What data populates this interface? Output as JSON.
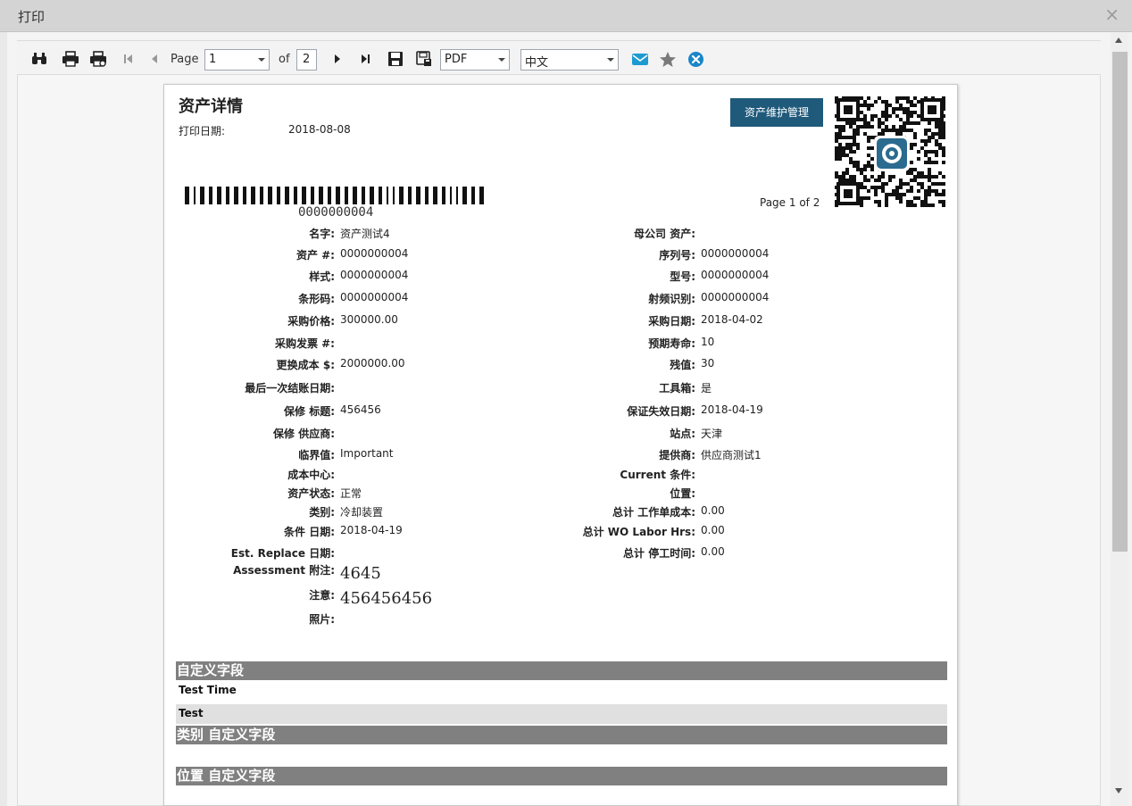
{
  "dialog": {
    "title": "打印",
    "close_glyph": "×"
  },
  "toolbar": {
    "page_label": "Page",
    "page_value": "1",
    "of_label": "of",
    "total_pages": "2",
    "format_value": "PDF",
    "language_value": "中文"
  },
  "report": {
    "title": "资产详情",
    "print_date_label": "打印日期:",
    "print_date_value": "2018-08-08",
    "brand_button": "资产维护管理",
    "barcode_number": "0000000004",
    "page_count": "Page 1 of 2",
    "left_fields": [
      {
        "label": "名字:",
        "value": "资产测试4"
      },
      {
        "label": "资产 #:",
        "value": "0000000004"
      },
      {
        "label": "样式:",
        "value": "0000000004"
      },
      {
        "label": "条形码:",
        "value": "0000000004"
      },
      {
        "label": "采购价格:",
        "value": "300000.00"
      },
      {
        "label": "采购发票 #:",
        "value": ""
      },
      {
        "label": "更换成本 $:",
        "value": "2000000.00"
      },
      {
        "label": "最后一次结账日期:",
        "value": ""
      },
      {
        "label": "保修 标题:",
        "value": "456456"
      },
      {
        "label": "保修 供应商:",
        "value": ""
      },
      {
        "label": "临界值:",
        "value": "Important"
      },
      {
        "label": "成本中心:",
        "value": ""
      },
      {
        "label": "资产状态:",
        "value": "正常"
      },
      {
        "label": "类别:",
        "value": "冷却装置"
      },
      {
        "label": "条件 日期:",
        "value": "2018-04-19"
      },
      {
        "label": "Est. Replace 日期:",
        "value": ""
      },
      {
        "label": "Assessment 附注:",
        "value": "4645"
      },
      {
        "label": "注意:",
        "value": "456456456"
      },
      {
        "label": "照片:",
        "value": ""
      }
    ],
    "right_fields": [
      {
        "label": "母公司 资产:",
        "value": ""
      },
      {
        "label": "序列号:",
        "value": "0000000004"
      },
      {
        "label": "型号:",
        "value": "0000000004"
      },
      {
        "label": "射频识别:",
        "value": "0000000004"
      },
      {
        "label": "采购日期:",
        "value": "2018-04-02"
      },
      {
        "label": "预期寿命:",
        "value": "10"
      },
      {
        "label": "残值:",
        "value": "30"
      },
      {
        "label": "工具箱:",
        "value": "是"
      },
      {
        "label": "保证失效日期:",
        "value": "2018-04-19"
      },
      {
        "label": "站点:",
        "value": "天津"
      },
      {
        "label": "提供商:",
        "value": "供应商测试1"
      },
      {
        "label": "Current 条件:",
        "value": ""
      },
      {
        "label": "位置:",
        "value": ""
      },
      {
        "label": "总计 工作单成本:",
        "value": "0.00"
      },
      {
        "label": "总计 WO Labor Hrs:",
        "value": "0.00"
      },
      {
        "label": "总计 停工时间:",
        "value": "0.00"
      }
    ],
    "sections": {
      "custom_fields": "自定义字段",
      "custom_rows": [
        "Test Time",
        "Test"
      ],
      "category_custom_fields": "类别 自定义字段",
      "location_custom_fields": "位置 自定义字段"
    }
  },
  "colors": {
    "brand_button": "#1f5a7b",
    "section_header": "#808080",
    "alt_row": "#e0e0e0",
    "title_bar": "#d4d4d4",
    "mail_icon": "#1d9bd1",
    "close_report_icon": "#1a86c8"
  },
  "icons": {
    "find": "binoculars-icon",
    "print": "printer-icon",
    "print_preview": "print-setup-icon",
    "first_page": "first-page-icon",
    "prev_page": "previous-page-icon",
    "next_page": "next-page-icon",
    "last_page": "last-page-icon",
    "save": "save-icon",
    "save_as": "save-as-icon",
    "mail": "mail-icon",
    "favorite": "star-icon",
    "close_report": "close-circle-icon"
  }
}
